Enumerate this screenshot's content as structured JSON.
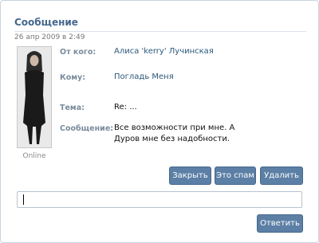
{
  "message": {
    "title": "Сообщение",
    "date": "26 апр 2009 в 2:49",
    "online": "Online",
    "from_label": "От кого:",
    "from_value": "Алиса 'kerry' Лучинская",
    "to_label": "Кому:",
    "to_value": "Погладь Меня",
    "subject_label": "Тема:",
    "subject_value": "Re: ...",
    "body_label": "Сообщение:",
    "body_value": "Все возможности при мне. А Дуров мне без надобности."
  },
  "buttons": {
    "close": "Закрыть",
    "spam": "Это спам",
    "delete": "Удалить",
    "reply": "Ответить"
  },
  "reply_input": {
    "value": ""
  },
  "colors": {
    "accent": "#5c7fa5",
    "link": "#2b587a",
    "title": "#45688e"
  }
}
